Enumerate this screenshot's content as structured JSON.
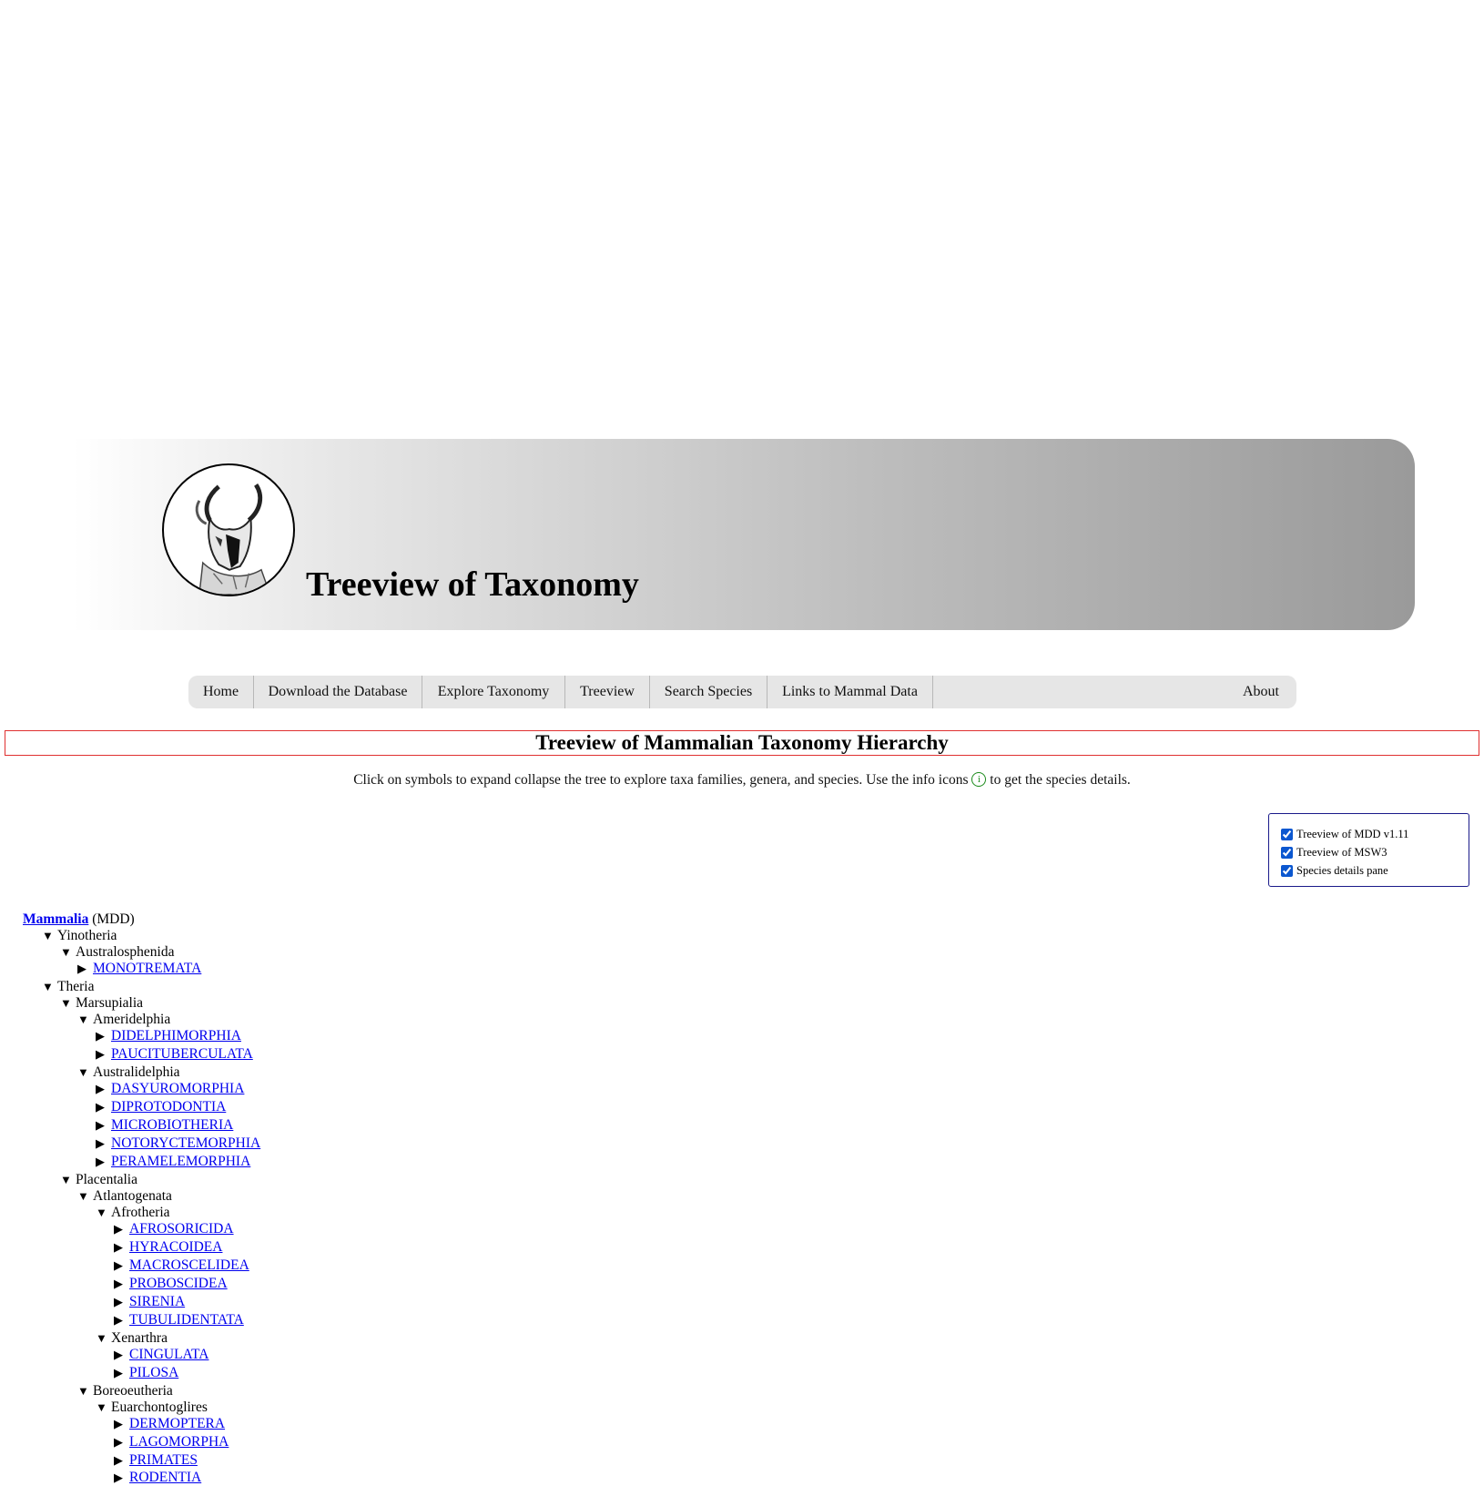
{
  "site_title": "Treeview of Taxonomy",
  "nav": {
    "home": "Home",
    "download": "Download the Database",
    "explore": "Explore Taxonomy",
    "treeview": "Treeview",
    "search": "Search Species",
    "links": "Links to Mammal Data",
    "about": "About"
  },
  "heading": "Treeview of Mammalian Taxonomy Hierarchy",
  "intro": {
    "before": "Click on symbols to expand collapse the tree to explore taxa families, genera, and species. Use the info icons",
    "after": "to get the species details."
  },
  "options": {
    "mdd": "Treeview of MDD v1.11",
    "msw3": "Treeview of MSW3",
    "details": "Species details pane"
  },
  "tree": {
    "root": "Mammalia",
    "root_suffix": "(MDD)",
    "expanded_symbol": "▼",
    "collapsed_symbol": "▶",
    "nodes": [
      "Yinotheria",
      "Australosphenida",
      "MONOTREMATA",
      "Theria",
      "Marsupialia",
      "Ameridelphia",
      "DIDELPHIMORPHIA",
      "PAUCITUBERCULATA",
      "Australidelphia",
      "DASYUROMORPHIA",
      "DIPROTODONTIA",
      "MICROBIOTHERIA",
      "NOTORYCTEMORPHIA",
      "PERAMELEMORPHIA",
      "Placentalia",
      "Atlantogenata",
      "Afrotheria",
      "AFROSORICIDA",
      "HYRACOIDEA",
      "MACROSCELIDEA",
      "PROBOSCIDEA",
      "SIRENIA",
      "TUBULIDENTATA",
      "Xenarthra",
      "CINGULATA",
      "PILOSA",
      "Boreoeutheria",
      "Euarchontoglires",
      "DERMOPTERA",
      "LAGOMORPHA",
      "PRIMATES",
      "RODENTIA"
    ]
  }
}
